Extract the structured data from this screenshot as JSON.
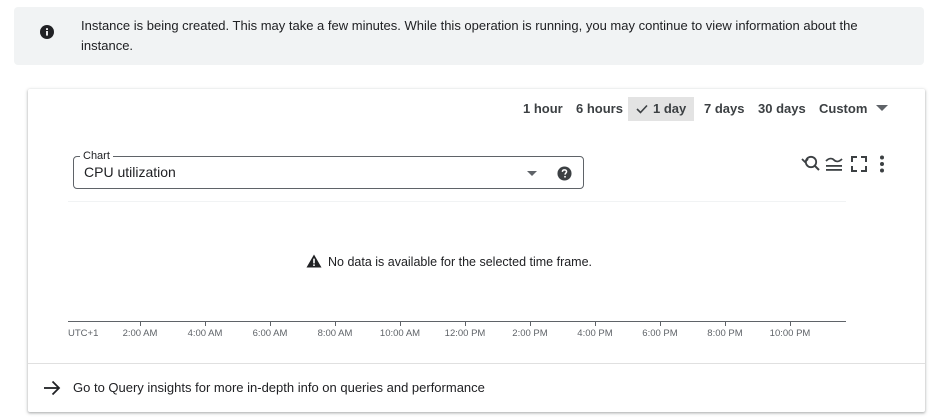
{
  "banner": {
    "icon": "info-icon",
    "message": "Instance is being created. This may take a few minutes. While this operation is running, you may continue to view information about the instance."
  },
  "range_tabs": [
    {
      "label": "1 hour",
      "selected": false
    },
    {
      "label": "6 hours",
      "selected": false
    },
    {
      "label": "1 day",
      "selected": true
    },
    {
      "label": "7 days",
      "selected": false
    },
    {
      "label": "30 days",
      "selected": false
    },
    {
      "label": "Custom",
      "selected": false,
      "dropdown": true
    }
  ],
  "chart_selector": {
    "label": "Chart",
    "value": "CPU utilization",
    "icons": [
      "dropdown-arrow-icon",
      "help-icon"
    ]
  },
  "toolbar_icons": [
    "zoom-reset-icon",
    "legend-toggle-icon",
    "fullscreen-icon",
    "more-vert-icon"
  ],
  "empty_state": {
    "icon": "warning-icon",
    "message": "No data is available for the selected time frame."
  },
  "x_axis": {
    "timezone": "UTC+1",
    "ticks": [
      "2:00 AM",
      "4:00 AM",
      "6:00 AM",
      "8:00 AM",
      "10:00 AM",
      "12:00 PM",
      "2:00 PM",
      "4:00 PM",
      "6:00 PM",
      "8:00 PM",
      "10:00 PM"
    ]
  },
  "insights_link": {
    "icon": "arrow-forward-icon",
    "label": "Go to Query insights for more in-depth info on queries and performance"
  },
  "colors": {
    "banner_bg": "#f1f3f4",
    "selected_tab_bg": "#e3e3e3",
    "text": "#202124",
    "muted": "#5f6368"
  }
}
